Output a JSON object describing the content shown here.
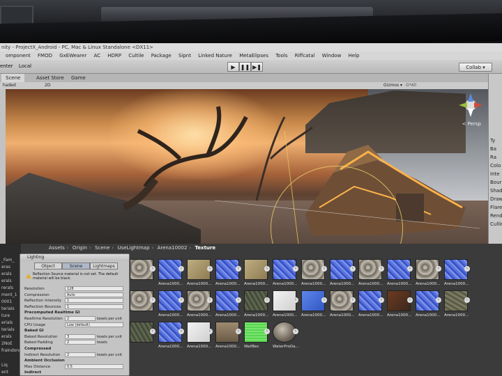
{
  "window": {
    "title": "nity - ProjectX_Android - PC, Mac & Linux Standalone <DX11>",
    "menu": [
      "omponent",
      "FMOD",
      "GxEWearer",
      "AC",
      "HDRP",
      "Cultile",
      "Package",
      "Sipnt",
      "Linked Nature",
      "MetaElipses",
      "Tools",
      "Riffcatal",
      "Window",
      "Help"
    ],
    "collab_label": "Collab ▾"
  },
  "toolbar": {
    "center_label": "enter",
    "local_label": "Local",
    "play_icons": [
      "▶",
      "❚❚",
      "▶❚"
    ]
  },
  "scene_view": {
    "tabs": [
      "Scene",
      "Asset Store",
      "Game"
    ],
    "shading_mode": "haded",
    "twod_label": "2D",
    "gizmos_label": "Gizmos ▾",
    "search_label": "G*All",
    "persp_label": "< Persp"
  },
  "inspector": {
    "labels": [
      "Ty",
      "Ba",
      "Ra",
      "Colo",
      "Inte",
      "Bour",
      "Shad",
      "Draw",
      "Flare",
      "Rende",
      "Cullin"
    ]
  },
  "hierarchy": {
    "items": [
      "",
      "",
      "",
      "",
      "",
      "",
      "_Fam_",
      "eras",
      "erals",
      "erals",
      "rerals",
      "ment_1",
      "0001",
      "terials",
      "ture",
      "erials",
      "terials",
      "erals",
      "2NoE",
      "fraIndone",
      "",
      "",
      "Liq",
      "ent"
    ]
  },
  "project": {
    "breadcrumb": [
      "Assets",
      "Origin",
      "Scene",
      "UseLightmap",
      "Arena10002"
    ],
    "breadcrumb_current": "Texture",
    "assets": [
      {
        "label": "",
        "type": "stone"
      },
      {
        "label": "Arena1000...",
        "type": "normal"
      },
      {
        "label": "Arena1000...",
        "type": "sand"
      },
      {
        "label": "Arena1000...",
        "type": "normal"
      },
      {
        "label": "Arena1000...",
        "type": "sand"
      },
      {
        "label": "Arena1000...",
        "type": "normal"
      },
      {
        "label": "Arena1000...",
        "type": "stone"
      },
      {
        "label": "Arena1000...",
        "type": "normal"
      },
      {
        "label": "Arena1000...",
        "type": "stone"
      },
      {
        "label": "Arena1000...",
        "type": "normal"
      },
      {
        "label": "Arena1000...",
        "type": "stone"
      },
      {
        "label": "Arena1000...",
        "type": "normal"
      },
      {
        "label": "",
        "type": "stone"
      },
      {
        "label": "Arena1000...",
        "type": "normal"
      },
      {
        "label": "Arena1000...",
        "type": "stone"
      },
      {
        "label": "Arena1000...",
        "type": "normal"
      },
      {
        "label": "Arena1000...",
        "type": "dark"
      },
      {
        "label": "Arena1000...",
        "type": "white"
      },
      {
        "label": "Arena1000...",
        "type": "blue"
      },
      {
        "label": "Arena1000...",
        "type": "stone"
      },
      {
        "label": "Arena1000...",
        "type": "normal"
      },
      {
        "label": "Arena1000...",
        "type": "rust"
      },
      {
        "label": "Arena1000...",
        "type": "normal"
      },
      {
        "label": "Arena1000...",
        "type": "moss"
      },
      {
        "label": "",
        "type": "dark"
      },
      {
        "label": "Arena1000...",
        "type": "normal"
      },
      {
        "label": "Arena1000...",
        "type": "white"
      },
      {
        "label": "Arena1000...",
        "type": "brown"
      },
      {
        "label": "WallBec",
        "type": "green"
      },
      {
        "label": "WaterProDa...",
        "type": "ball"
      }
    ]
  },
  "lighting": {
    "title": "Lighting",
    "tabs": [
      "Object",
      "Scene",
      "Lightmaps"
    ],
    "active_tab": "Scene",
    "warning": "Reflection Source material is not set. The default material will be black.",
    "rows": [
      {
        "label": "Resolution",
        "value": "128"
      },
      {
        "label": "Compression",
        "value": "Auto"
      },
      {
        "label": "Reflection Intensity",
        "value": "1"
      },
      {
        "label": "Reflection Bounces",
        "value": "1"
      },
      {
        "label": "Precomputed Realtime GI",
        "value": ""
      },
      {
        "label": "Realtime Resolution",
        "value": "2",
        "unit": "texels per unit"
      },
      {
        "label": "CPU Usage",
        "value": "Low (default)"
      },
      {
        "label": "Baked GI",
        "value": ""
      },
      {
        "label": "Baked Resolution",
        "value": "3",
        "unit": "texels per unit"
      },
      {
        "label": "Baked Padding",
        "value": "2",
        "unit": "texels"
      },
      {
        "label": "Compressed",
        "value": ""
      },
      {
        "label": "Indirect Resolution",
        "value": "2",
        "unit": "texels per unit"
      },
      {
        "label": "Ambient Occlusion",
        "value": ""
      },
      {
        "label": "Max Distance",
        "value": "0.5"
      },
      {
        "label": "Indirect",
        "value": ""
      }
    ]
  },
  "colors": {
    "editor_bg": "#c2c2c2",
    "project_bg": "#3b3b3b",
    "selection_ring": "#f2d26a",
    "warning_icon": "#e0b12c"
  }
}
